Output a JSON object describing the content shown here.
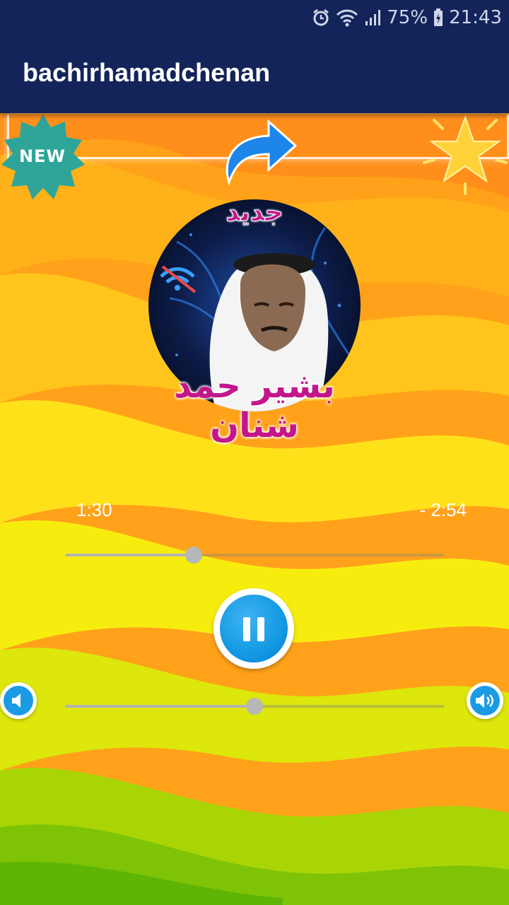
{
  "status_bar": {
    "battery": "75%",
    "time": "21:43",
    "icons": [
      "alarm-icon",
      "wifi-icon",
      "signal-icon",
      "battery-charging-icon"
    ]
  },
  "app_bar": {
    "title": "bachirhamadchenan",
    "color": "#13245a"
  },
  "decorations": {
    "new_badge": "NEW",
    "share_icon": "share-arrow-icon",
    "rate_icon": "star-icon"
  },
  "album_art": {
    "top_label": "جديد",
    "bottom_label": "بشير حمد شنان",
    "label_color": "#c3168c"
  },
  "player": {
    "elapsed": "1:30",
    "remaining": "- 2:54",
    "seek_progress": 0.34,
    "volume_level": 0.5,
    "accent": "#1299e3"
  },
  "controls": {
    "pause_icon": "pause-icon",
    "volume_down_icon": "volume-down-icon",
    "volume_up_icon": "volume-up-icon"
  }
}
